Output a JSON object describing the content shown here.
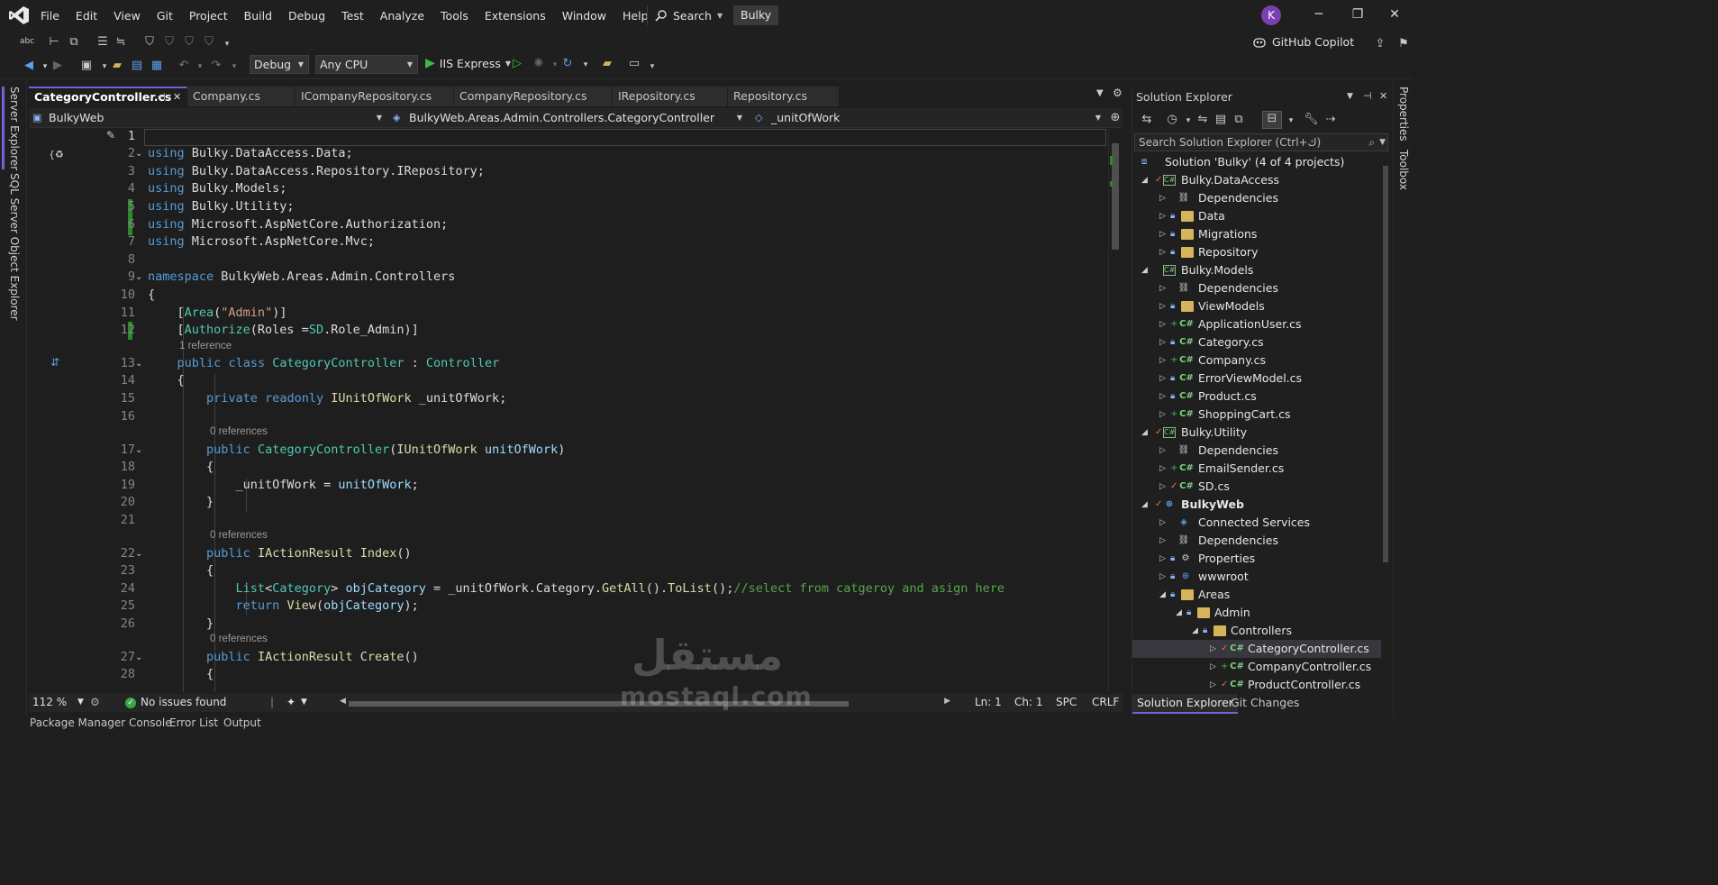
{
  "menu": {
    "items": [
      "File",
      "Edit",
      "View",
      "Git",
      "Project",
      "Build",
      "Debug",
      "Test",
      "Analyze",
      "Tools",
      "Extensions",
      "Window",
      "Help"
    ],
    "search_label": "Search",
    "solution_badge": "Bulky",
    "avatar_initial": "K"
  },
  "toolbar": {
    "copilot_label": "GitHub Copilot",
    "config": "Debug",
    "platform": "Any CPU",
    "run_label": "IIS Express"
  },
  "left_strip": {
    "server_explorer": "Server Explorer",
    "sql_explorer": "SQL Server Object Explorer"
  },
  "right_strip": {
    "properties": "Properties",
    "toolbox": "Toolbox"
  },
  "tabs": [
    {
      "label": "CategoryController.cs",
      "active": true
    },
    {
      "label": "Company.cs",
      "active": false
    },
    {
      "label": "ICompanyRepository.cs",
      "active": false
    },
    {
      "label": "CompanyRepository.cs",
      "active": false
    },
    {
      "label": "IRepository.cs",
      "active": false
    },
    {
      "label": "Repository.cs",
      "active": false
    }
  ],
  "navbar": {
    "project": "BulkyWeb",
    "type": "BulkyWeb.Areas.Admin.Controllers.CategoryController",
    "member": "_unitOfWork"
  },
  "code": {
    "lens_1ref": "1 reference",
    "lens_0ref": "0 references",
    "line_numbers": [
      "1",
      "2",
      "3",
      "4",
      "5",
      "6",
      "7",
      "8",
      "9",
      "10",
      "11",
      "12",
      "13",
      "14",
      "15",
      "16",
      "17",
      "18",
      "19",
      "20",
      "21",
      "22",
      "23",
      "24",
      "25",
      "26",
      "27",
      "28"
    ]
  },
  "editor_status": {
    "zoom": "112 %",
    "issues": "No issues found",
    "ln": "Ln: 1",
    "ch": "Ch: 1",
    "spc": "SPC",
    "crlf": "CRLF"
  },
  "bottom_tabs": [
    "Package Manager Console",
    "Error List",
    "Output"
  ],
  "solution_explorer": {
    "title": "Solution Explorer",
    "search_placeholder": "Search Solution Explorer (Ctrl+ك)",
    "nodes": [
      {
        "label": "Solution 'Bulky' (4 of 4 projects)",
        "icon": "solution-icon"
      },
      {
        "label": "Bulky.DataAccess",
        "icon": "project-icon"
      },
      {
        "label": "Dependencies",
        "icon": "dependencies-icon"
      },
      {
        "label": "Data",
        "icon": "folder-icon"
      },
      {
        "label": "Migrations",
        "icon": "folder-icon"
      },
      {
        "label": "Repository",
        "icon": "folder-icon"
      },
      {
        "label": "Bulky.Models",
        "icon": "project-icon"
      },
      {
        "label": "Dependencies",
        "icon": "dependencies-icon"
      },
      {
        "label": "ViewModels",
        "icon": "folder-icon"
      },
      {
        "label": "ApplicationUser.cs",
        "icon": "csharp-file-icon"
      },
      {
        "label": "Category.cs",
        "icon": "csharp-file-icon"
      },
      {
        "label": "Company.cs",
        "icon": "csharp-file-icon"
      },
      {
        "label": "ErrorViewModel.cs",
        "icon": "csharp-file-icon"
      },
      {
        "label": "Product.cs",
        "icon": "csharp-file-icon"
      },
      {
        "label": "ShoppingCart.cs",
        "icon": "csharp-file-icon"
      },
      {
        "label": "Bulky.Utility",
        "icon": "project-icon"
      },
      {
        "label": "Dependencies",
        "icon": "dependencies-icon"
      },
      {
        "label": "EmailSender.cs",
        "icon": "csharp-file-icon"
      },
      {
        "label": "SD.cs",
        "icon": "csharp-file-icon"
      },
      {
        "label": "BulkyWeb",
        "icon": "web-project-icon"
      },
      {
        "label": "Connected Services",
        "icon": "connected-services-icon"
      },
      {
        "label": "Dependencies",
        "icon": "dependencies-icon"
      },
      {
        "label": "Properties",
        "icon": "properties-folder-icon"
      },
      {
        "label": "wwwroot",
        "icon": "globe-icon"
      },
      {
        "label": "Areas",
        "icon": "folder-icon"
      },
      {
        "label": "Admin",
        "icon": "folder-icon"
      },
      {
        "label": "Controllers",
        "icon": "folder-icon"
      },
      {
        "label": "CategoryController.cs",
        "icon": "csharp-file-icon"
      },
      {
        "label": "CompanyController.cs",
        "icon": "csharp-file-icon"
      },
      {
        "label": "ProductController.cs",
        "icon": "csharp-file-icon"
      }
    ],
    "bottom_tabs": [
      "Solution Explorer",
      "Git Changes"
    ]
  },
  "watermark": {
    "arabic": "مستقل",
    "latin": "mostaql.com"
  },
  "colors": {
    "accent": "#7a5fd8",
    "keyword": "#569cd6",
    "type": "#4ec9b0",
    "string": "#d69d85",
    "comment": "#57a64a",
    "change_bar": "#2c8a2c"
  }
}
